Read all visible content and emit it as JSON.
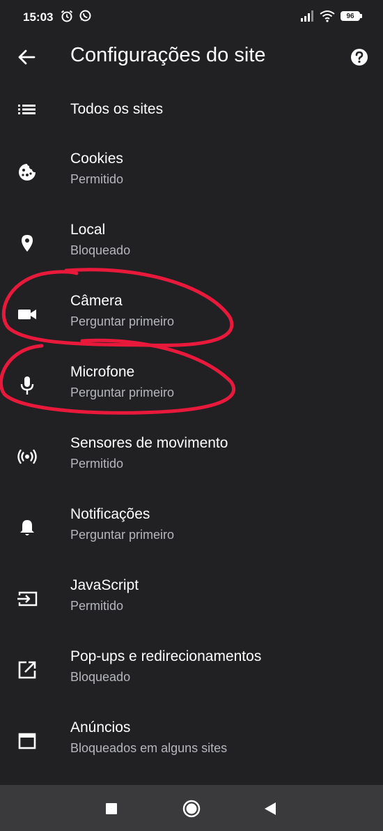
{
  "status_bar": {
    "time": "15:03",
    "battery": "96",
    "icons": [
      "alarm-icon",
      "whatsapp-icon",
      "signal-icon",
      "wifi-icon",
      "battery-icon"
    ]
  },
  "app_bar": {
    "title": "Configurações do site",
    "back_icon": "back-arrow-icon",
    "help_icon": "help-icon"
  },
  "list": {
    "all_sites": {
      "title": "Todos os sites",
      "icon": "list-icon"
    },
    "items": [
      {
        "title": "Cookies",
        "subtitle": "Permitido",
        "icon": "cookie-icon"
      },
      {
        "title": "Local",
        "subtitle": "Bloqueado",
        "icon": "location-icon"
      },
      {
        "title": "Câmera",
        "subtitle": "Perguntar primeiro",
        "icon": "camera-icon"
      },
      {
        "title": "Microfone",
        "subtitle": "Perguntar primeiro",
        "icon": "microphone-icon"
      },
      {
        "title": "Sensores de movimento",
        "subtitle": "Permitido",
        "icon": "sensors-icon"
      },
      {
        "title": "Notificações",
        "subtitle": "Perguntar primeiro",
        "icon": "bell-icon"
      },
      {
        "title": "JavaScript",
        "subtitle": "Permitido",
        "icon": "javascript-icon"
      },
      {
        "title": "Pop-ups e redirecionamentos",
        "subtitle": "Bloqueado",
        "icon": "popup-icon"
      },
      {
        "title": "Anúncios",
        "subtitle": "Bloqueados em alguns sites",
        "icon": "ads-icon"
      }
    ]
  },
  "nav_bar": {
    "buttons": [
      "recents-icon",
      "home-icon",
      "back-icon"
    ]
  },
  "colors": {
    "background": "#212124",
    "text": "#ffffff",
    "subtitle": "#b6b7bb",
    "annotation": "#e8193a",
    "nav": "#3a3a3c"
  }
}
